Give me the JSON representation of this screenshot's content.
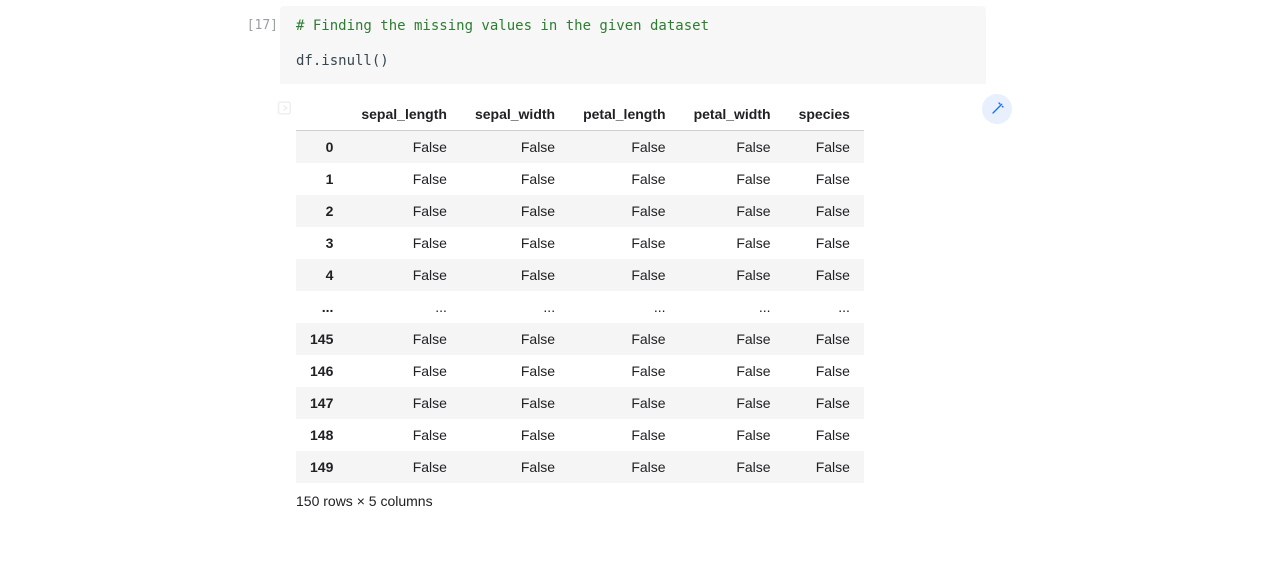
{
  "cell": {
    "exec_label": "[17]",
    "comment": "# Finding the missing values in the given dataset",
    "code": "df.isnull()"
  },
  "output": {
    "columns": [
      "sepal_length",
      "sepal_width",
      "petal_length",
      "petal_width",
      "species"
    ],
    "rows": [
      {
        "index": "0",
        "values": [
          "False",
          "False",
          "False",
          "False",
          "False"
        ]
      },
      {
        "index": "1",
        "values": [
          "False",
          "False",
          "False",
          "False",
          "False"
        ]
      },
      {
        "index": "2",
        "values": [
          "False",
          "False",
          "False",
          "False",
          "False"
        ]
      },
      {
        "index": "3",
        "values": [
          "False",
          "False",
          "False",
          "False",
          "False"
        ]
      },
      {
        "index": "4",
        "values": [
          "False",
          "False",
          "False",
          "False",
          "False"
        ]
      },
      {
        "index": "...",
        "values": [
          "...",
          "...",
          "...",
          "...",
          "..."
        ]
      },
      {
        "index": "145",
        "values": [
          "False",
          "False",
          "False",
          "False",
          "False"
        ]
      },
      {
        "index": "146",
        "values": [
          "False",
          "False",
          "False",
          "False",
          "False"
        ]
      },
      {
        "index": "147",
        "values": [
          "False",
          "False",
          "False",
          "False",
          "False"
        ]
      },
      {
        "index": "148",
        "values": [
          "False",
          "False",
          "False",
          "False",
          "False"
        ]
      },
      {
        "index": "149",
        "values": [
          "False",
          "False",
          "False",
          "False",
          "False"
        ]
      }
    ],
    "shape_text": "150 rows × 5 columns"
  },
  "icons": {
    "out_marker": "output-marker-icon",
    "magic": "magic-wand-icon"
  },
  "colors": {
    "comment": "#2e7d32",
    "magic_bg": "#e8f0fe",
    "magic_fg": "#1a73e8"
  }
}
